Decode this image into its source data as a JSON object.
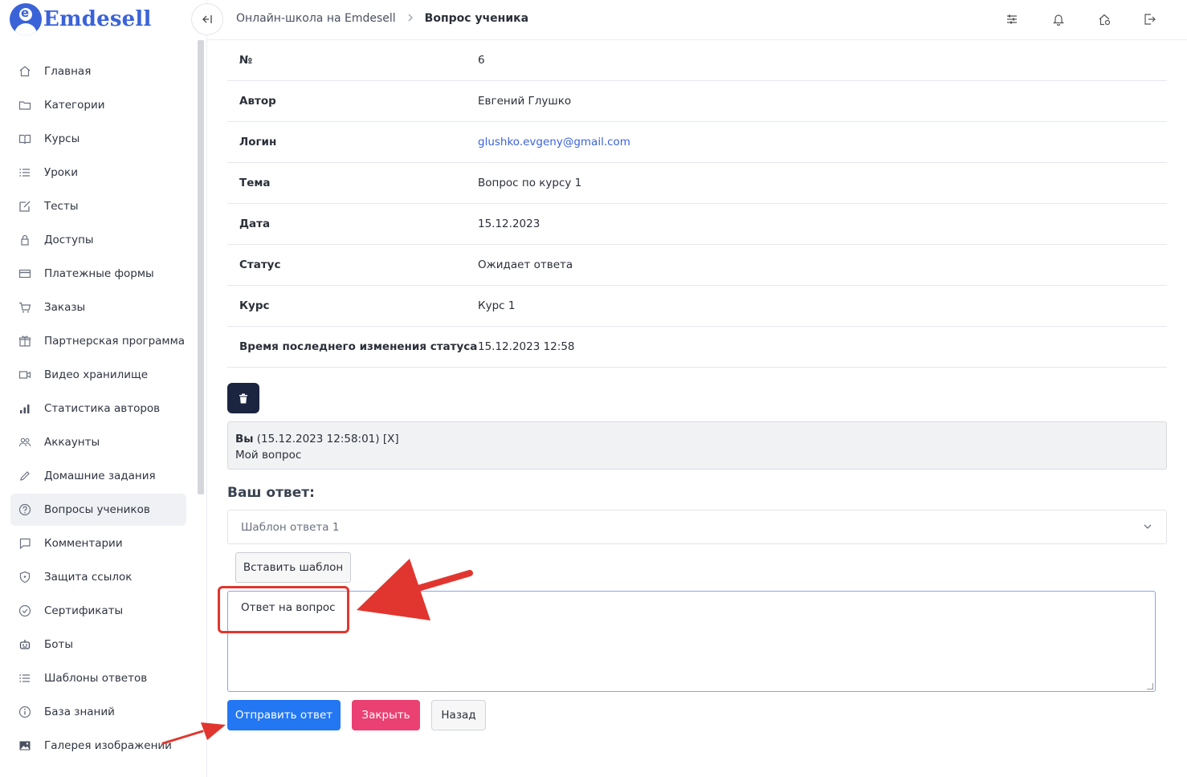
{
  "brand": {
    "name": "Emdesell",
    "logo_letter": "e"
  },
  "sidebar": {
    "items": [
      {
        "label": "Главная",
        "icon": "home-icon"
      },
      {
        "label": "Категории",
        "icon": "folder-icon"
      },
      {
        "label": "Курсы",
        "icon": "book-icon"
      },
      {
        "label": "Уроки",
        "icon": "list-icon"
      },
      {
        "label": "Тесты",
        "icon": "edit-icon"
      },
      {
        "label": "Доступы",
        "icon": "lock-icon"
      },
      {
        "label": "Платежные формы",
        "icon": "credit-card-icon"
      },
      {
        "label": "Заказы",
        "icon": "cart-icon"
      },
      {
        "label": "Партнерская программа",
        "icon": "gift-icon"
      },
      {
        "label": "Видео хранилище",
        "icon": "video-icon"
      },
      {
        "label": "Статистика авторов",
        "icon": "bar-chart-icon"
      },
      {
        "label": "Аккаунты",
        "icon": "users-icon"
      },
      {
        "label": "Домашние задания",
        "icon": "pencil-icon"
      },
      {
        "label": "Вопросы учеников",
        "icon": "help-circle-icon",
        "active": true
      },
      {
        "label": "Комментарии",
        "icon": "message-icon"
      },
      {
        "label": "Защита ссылок",
        "icon": "shield-icon"
      },
      {
        "label": "Сертификаты",
        "icon": "check-circle-icon"
      },
      {
        "label": "Боты",
        "icon": "robot-icon"
      },
      {
        "label": "Шаблоны ответов",
        "icon": "list-icon"
      },
      {
        "label": "База знаний",
        "icon": "info-icon"
      },
      {
        "label": "Галерея изображений",
        "icon": "image-icon"
      }
    ]
  },
  "header": {
    "breadcrumb": [
      "Онлайн-школа на Emdesell",
      "Вопрос ученика"
    ],
    "icons": [
      "sliders-icon",
      "bell-icon",
      "home-settings-icon",
      "logout-icon"
    ]
  },
  "details": [
    {
      "key": "№",
      "value": "6"
    },
    {
      "key": "Автор",
      "value": "Евгений Глушко"
    },
    {
      "key": "Логин",
      "value": "glushko.evgeny@gmail.com",
      "link": true
    },
    {
      "key": "Тема",
      "value": "Вопрос по курсу 1"
    },
    {
      "key": "Дата",
      "value": "15.12.2023"
    },
    {
      "key": "Статус",
      "value": "Ожидает ответа"
    },
    {
      "key": "Курс",
      "value": "Курс 1"
    },
    {
      "key": "Время последнего изменения статуса",
      "value": "15.12.2023 12:58"
    }
  ],
  "message": {
    "author": "Вы",
    "meta": " (15.12.2023 12:58:01) [X]",
    "text": "Мой вопрос"
  },
  "answer": {
    "title": "Ваш ответ:",
    "template_selected": "Шаблон ответа 1",
    "insert_label": "Вставить шаблон",
    "text": "Ответ на вопрос"
  },
  "actions": {
    "send": "Отправить ответ",
    "close": "Закрыть",
    "back": "Назад"
  },
  "colors": {
    "accent": "#2477f2",
    "brand": "#3b63d8",
    "danger": "#ea4072",
    "annotation": "#e0362f",
    "dark": "#1b2540"
  }
}
